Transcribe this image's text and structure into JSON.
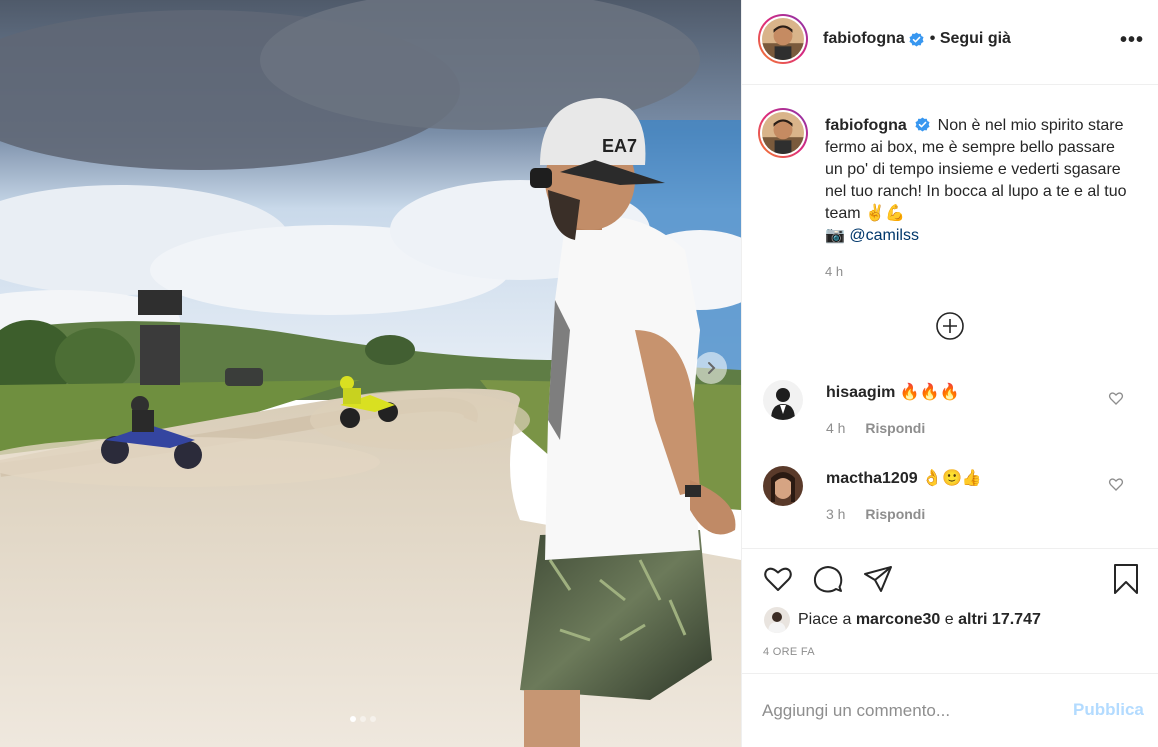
{
  "post": {
    "author": "fabiofogna",
    "follow_status": "• Segui già",
    "more_label": "•••",
    "caption_text": "Non è nel mio spirito stare fermo ai box, me è sempre bello passare un po' di tempo insieme e vederti sgasare nel tuo ranch! In bocca al lupo a te e al tuo team ✌️💪",
    "caption_camera": "📷",
    "caption_mention": "@camilss",
    "caption_time": "4 h",
    "brand_cap_text": "EA7"
  },
  "comments": [
    {
      "username": "hisaagim",
      "text": "🔥🔥🔥",
      "time": "4 h",
      "reply_label": "Rispondi"
    },
    {
      "username": "mactha1209",
      "text": "👌🙂👍",
      "time": "3 h",
      "reply_label": "Rispondi"
    }
  ],
  "likes": {
    "prefix": "Piace a",
    "user": "marcone30",
    "middle": "e",
    "others": "altri 17.747"
  },
  "post_date": "4 ORE FA",
  "comment_box": {
    "placeholder": "Aggiungi un commento...",
    "publish_label": "Pubblica"
  },
  "icons": {
    "verified": "verified-badge-icon",
    "more": "more-options-icon",
    "load_more": "plus-circle-icon",
    "like": "heart-icon",
    "comment": "comment-bubble-icon",
    "share": "paper-plane-icon",
    "save": "bookmark-icon",
    "next": "chevron-right-icon"
  },
  "carousel": {
    "total_slides": 3,
    "active_slide": 1
  },
  "colors": {
    "verified_blue": "#3897f0",
    "publish_disabled": "#b3dbff",
    "mention": "#00376b",
    "secondary_text": "#8e8e8e"
  }
}
